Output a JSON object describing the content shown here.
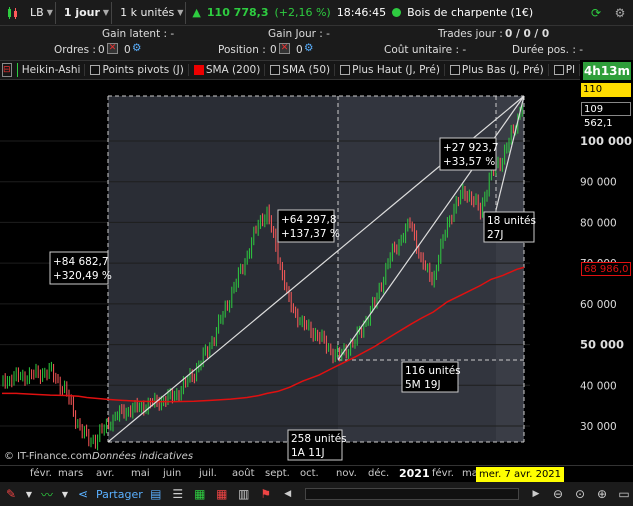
{
  "toolbar": {
    "exchange": "LB",
    "period": "1 jour",
    "units": "1 k unités",
    "price": "110 778,3",
    "change": "(+2,16 %)",
    "time": "18:46:45",
    "instrument": "Bois de charpente (1€)"
  },
  "info": {
    "gain_latent": "Gain latent : -",
    "gain_jour": "Gain Jour : -",
    "trades_jour_label": "Trades jour :",
    "trades_jour_value": "0 / 0 / 0",
    "ordres_label": "Ordres :",
    "ordres_value": "0",
    "ordres_value2": "0",
    "position_label": "Position :",
    "position_value": "0",
    "position_value2": "0",
    "cout_unitaire": "Coût unitaire : -",
    "duree_pos": "Durée pos. : -"
  },
  "indicators": [
    "Heikin-Ashi",
    "Points pivots (J)",
    "SMA (200)",
    "SMA (50)",
    "Plus Haut (J, Pré)",
    "Plus Bas (J, Pré)",
    "Pl"
  ],
  "timer": "4h13m",
  "price_tags": {
    "current": "110 778,3",
    "prev": "109 562,1",
    "sma": "68 986,0"
  },
  "y_ticks": [
    "100 000",
    "90 000",
    "80 000",
    "70 000",
    "60 000",
    "50 000",
    "40 000",
    "30 000"
  ],
  "months": [
    "févr.",
    "mars",
    "avr.",
    "mai",
    "juin",
    "juil.",
    "août",
    "sept.",
    "oct.",
    "nov.",
    "déc.",
    "2021",
    "févr.",
    "ma"
  ],
  "date_tag": "mer. 7 avr. 2021",
  "annotations": {
    "a1_line1": "+84 682,7",
    "a1_line2": "+320,49 %",
    "a2_line1": "+64 297,8",
    "a2_line2": "+137,37 %",
    "a3_line1": "+27 923,7",
    "a3_line2": "+33,57 %",
    "u1_line1": "258 unités",
    "u1_line2": "1A 11J",
    "u2_line1": "116 unités",
    "u2_line2": "5M 19J",
    "u3_line1": "18 unités",
    "u3_line2": "27J"
  },
  "watermark": "© IT-Finance.com",
  "watermark2": "Données indicatives",
  "bottom": {
    "share": "Partager"
  },
  "colors": {
    "up": "#2ecc40",
    "down": "#ff5a5a",
    "sma": "#e01010",
    "timer": "#2e9e3a",
    "datetag": "#ffff00"
  },
  "chart_data": {
    "type": "line",
    "title": "",
    "xlabel": "",
    "ylabel": "",
    "ylim": [
      25000,
      112000
    ],
    "x": [
      "2020-01-20",
      "2020-02-01",
      "2020-02-15",
      "2020-03-01",
      "2020-03-15",
      "2020-03-25",
      "2020-04-01",
      "2020-04-08",
      "2020-04-20",
      "2020-05-01",
      "2020-05-15",
      "2020-06-01",
      "2020-06-15",
      "2020-07-01",
      "2020-07-15",
      "2020-08-01",
      "2020-08-15",
      "2020-08-25",
      "2020-09-01",
      "2020-09-10",
      "2020-09-20",
      "2020-10-01",
      "2020-10-15",
      "2020-10-25",
      "2020-11-01",
      "2020-11-15",
      "2020-12-01",
      "2020-12-15",
      "2021-01-01",
      "2021-01-10",
      "2021-01-20",
      "2021-02-01",
      "2021-02-15",
      "2021-03-01",
      "2021-03-10",
      "2021-03-20",
      "2021-04-01",
      "2021-04-07"
    ],
    "series": [
      {
        "name": "Heikin-Ashi",
        "values": [
          41000,
          42000,
          42500,
          43500,
          38000,
          30000,
          27000,
          26500,
          31000,
          33500,
          34500,
          36000,
          37500,
          43000,
          50000,
          62000,
          72000,
          80000,
          82500,
          72000,
          60000,
          55000,
          52000,
          48500,
          47000,
          51000,
          60000,
          72000,
          80000,
          70000,
          66000,
          80000,
          88000,
          83000,
          92000,
          96000,
          105000,
          110778
        ]
      },
      {
        "name": "SMA (200)",
        "values": [
          38000,
          38000,
          37800,
          37600,
          37500,
          37300,
          37000,
          36800,
          36500,
          36300,
          36100,
          36000,
          36000,
          36100,
          36300,
          36600,
          37000,
          37500,
          38000,
          38500,
          39500,
          41000,
          42500,
          44000,
          45000,
          47000,
          49500,
          52000,
          55000,
          56500,
          58000,
          60500,
          62500,
          64500,
          66000,
          67000,
          68500,
          68986
        ]
      }
    ]
  }
}
